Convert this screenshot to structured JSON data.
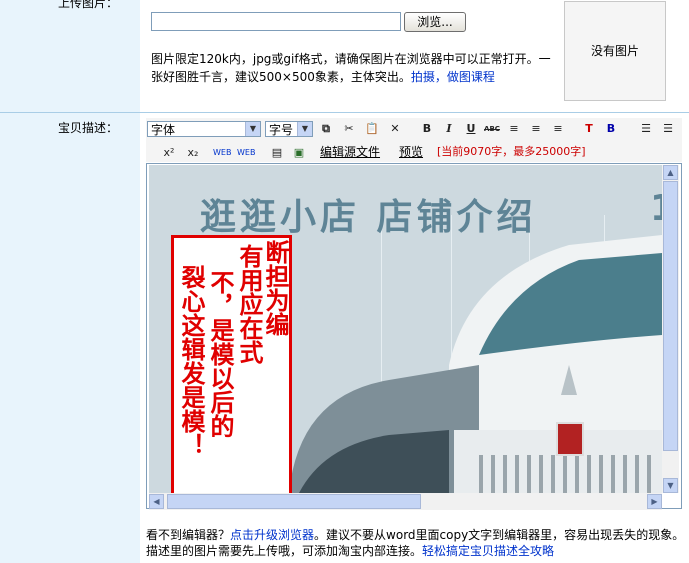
{
  "upload": {
    "label": "上传图片：",
    "browse_label": "浏览...",
    "hint_text": "图片限定120k内，jpg或gif格式，请确保图片在浏览器中可以正常打开。一张好图胜千言，建议500×500象素，主体突出。",
    "hint_link": "拍摄，做图课程",
    "preview_text": "没有图片"
  },
  "description": {
    "label": "宝贝描述："
  },
  "toolbar": {
    "font_select": "字体",
    "size_select": "字号",
    "bold": "B",
    "italic": "I",
    "underline": "U",
    "strike": "ABC",
    "superscript": "x²",
    "subscript": "x₂",
    "edit_source": "编辑源文件",
    "preview": "预览",
    "counter": "[当前9070字，最多25000字]"
  },
  "editor": {
    "banner_text": "逛逛小店  店铺介绍",
    "banner_partial": "1",
    "warning_lines": [
      "断",
      "有担",
      "不用为",
      "裂应编",
      "心，在式，",
      "这是模后",
      "辑布以的",
      "发是整",
      "是完哦！",
      "模版",
      "！"
    ],
    "warning_columns": [
      "断担为编",
      "有用应在式",
      "不，是模以后的",
      "裂心这辑发是模！"
    ]
  },
  "footer": {
    "text_a": "看不到编辑器？",
    "link_a": "点击升级浏览器",
    "text_b": "。建议不要从word里面copy文字到编辑器里，容易出现丢失的现象。描述里的图片需要先上传哦，可添加淘宝内部连接。",
    "link_b": "轻松搞定宝贝描述全攻略"
  }
}
